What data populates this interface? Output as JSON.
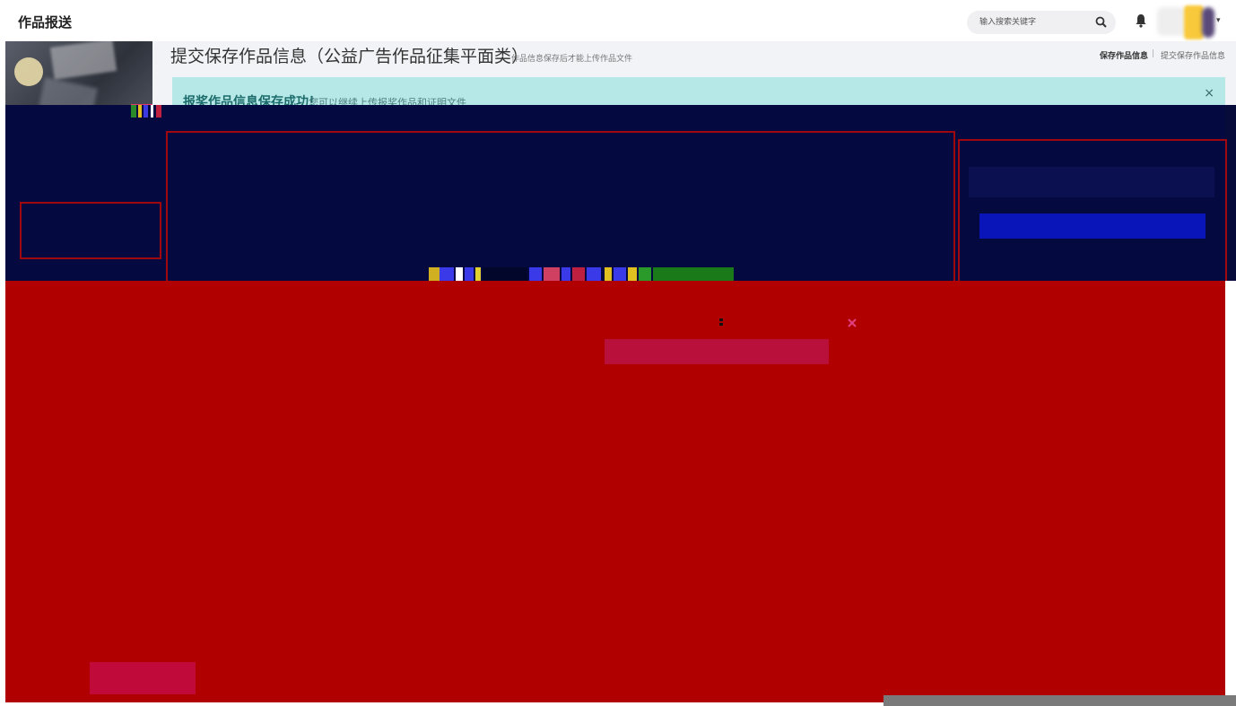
{
  "header": {
    "app_title": "作品报送",
    "search_placeholder": "输入搜索关键字",
    "search_icon": "search-icon",
    "bell_icon": "bell-icon"
  },
  "page": {
    "title": "提交保存作品信息（公益广告作品征集平面类）",
    "hint": "作品信息保存后才能上传作品文件",
    "actions": {
      "save_label": "保存作品信息",
      "separator": "|",
      "submit_label": "提交保存作品信息"
    }
  },
  "alert": {
    "strong": "报奖作品信息保存成功！",
    "message": "您可以继续上传报奖作品和证明文件",
    "close": "×"
  },
  "colors": {
    "navy_overlay": "#04093f",
    "red_overlay": "#b00000",
    "alert_bg": "#b7e8e8",
    "outline_red": "#a00810",
    "button_blue": "#0915b8"
  }
}
